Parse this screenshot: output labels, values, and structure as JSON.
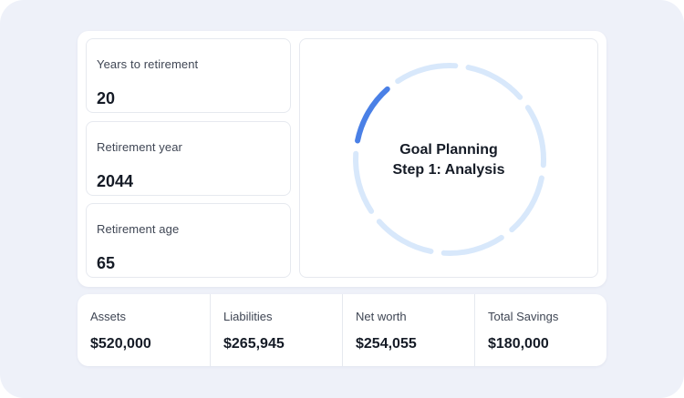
{
  "stats": [
    {
      "label": "Years to retirement",
      "value": "20"
    },
    {
      "label": "Retirement year",
      "value": "2044"
    },
    {
      "label": "Retirement age",
      "value": "65"
    }
  ],
  "goal": {
    "title": "Goal Planning",
    "step": "Step 1: Analysis",
    "progress": 0.125,
    "segments": 8,
    "colors": {
      "active": "#4a80e6",
      "inactive": "#d8e8fb"
    }
  },
  "summary": [
    {
      "label": "Assets",
      "value": "$520,000"
    },
    {
      "label": "Liabilities",
      "value": "$265,945"
    },
    {
      "label": "Net worth",
      "value": "$254,055"
    },
    {
      "label": "Total Savings",
      "value": "$180,000"
    }
  ]
}
